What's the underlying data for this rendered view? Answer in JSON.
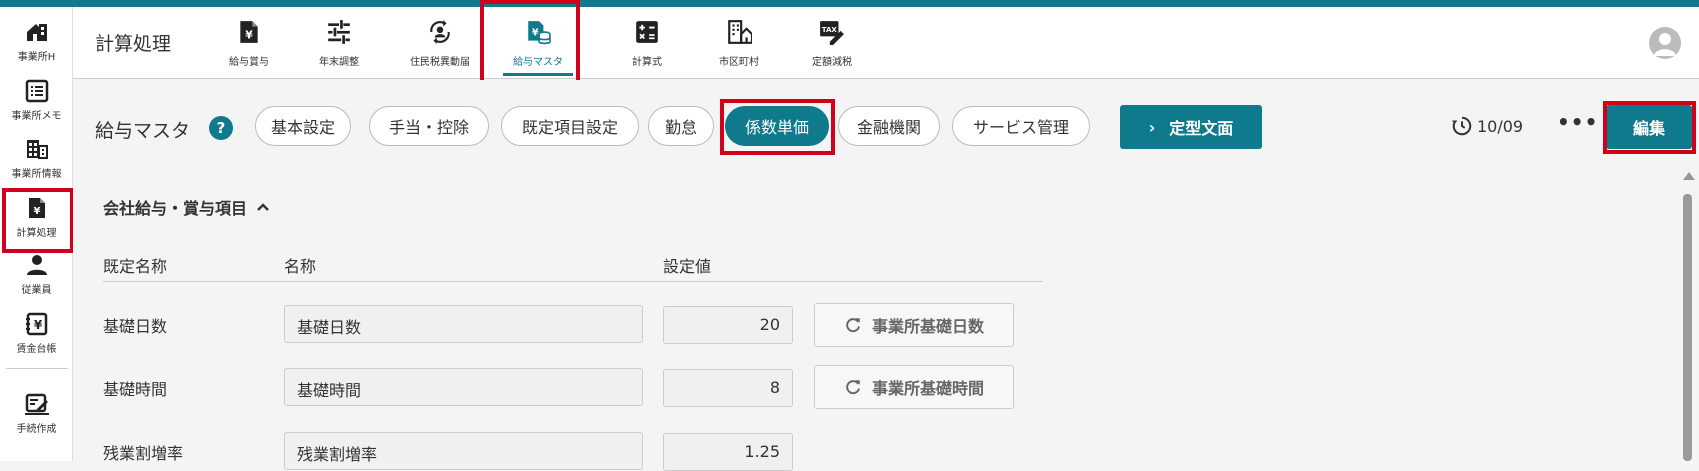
{
  "sidebar": {
    "items": [
      {
        "label": "事業所H",
        "icon": "office-home-icon"
      },
      {
        "label": "事業所メモ",
        "icon": "memo-list-icon"
      },
      {
        "label": "事業所情報",
        "icon": "building-icon"
      },
      {
        "label": "計算処理",
        "icon": "yen-document-icon"
      },
      {
        "label": "従業員",
        "icon": "person-icon"
      },
      {
        "label": "賃金台帳",
        "icon": "ledger-yen-icon"
      },
      {
        "label": "手続作成",
        "icon": "edit-document-icon"
      }
    ]
  },
  "header": {
    "title": "計算処理",
    "tabs": [
      {
        "label": "給与賞与",
        "icon": "yen-document-icon"
      },
      {
        "label": "年末調整",
        "icon": "sliders-icon"
      },
      {
        "label": "住民税異動届",
        "icon": "person-cycle-icon"
      },
      {
        "label": "給与マスタ",
        "icon": "yen-database-icon"
      },
      {
        "label": "計算式",
        "icon": "calculator-icon"
      },
      {
        "label": "市区町村",
        "icon": "city-hall-icon"
      },
      {
        "label": "定額減税",
        "icon": "tax-edit-icon"
      }
    ]
  },
  "page": {
    "title": "給与マスタ",
    "help": "?",
    "pills": [
      "基本設定",
      "手当・控除",
      "既定項目設定",
      "勤怠",
      "係数単価",
      "金融機関",
      "サービス管理"
    ],
    "template_button": "定型文面",
    "history_date": "10/09",
    "more": "•••",
    "edit_button": "編集"
  },
  "section": {
    "title": "会社給与・賞与項目",
    "columns": [
      "既定名称",
      "名称",
      "設定値"
    ],
    "rows": [
      {
        "label": "基礎日数",
        "name": "基礎日数",
        "value": "20",
        "reset": "事業所基礎日数"
      },
      {
        "label": "基礎時間",
        "name": "基礎時間",
        "value": "8",
        "reset": "事業所基礎時間"
      },
      {
        "label": "残業割増率",
        "name": "残業割増率",
        "value": "1.25"
      }
    ]
  },
  "colors": {
    "accent": "#0e7a8c",
    "highlight": "#d0021b"
  }
}
